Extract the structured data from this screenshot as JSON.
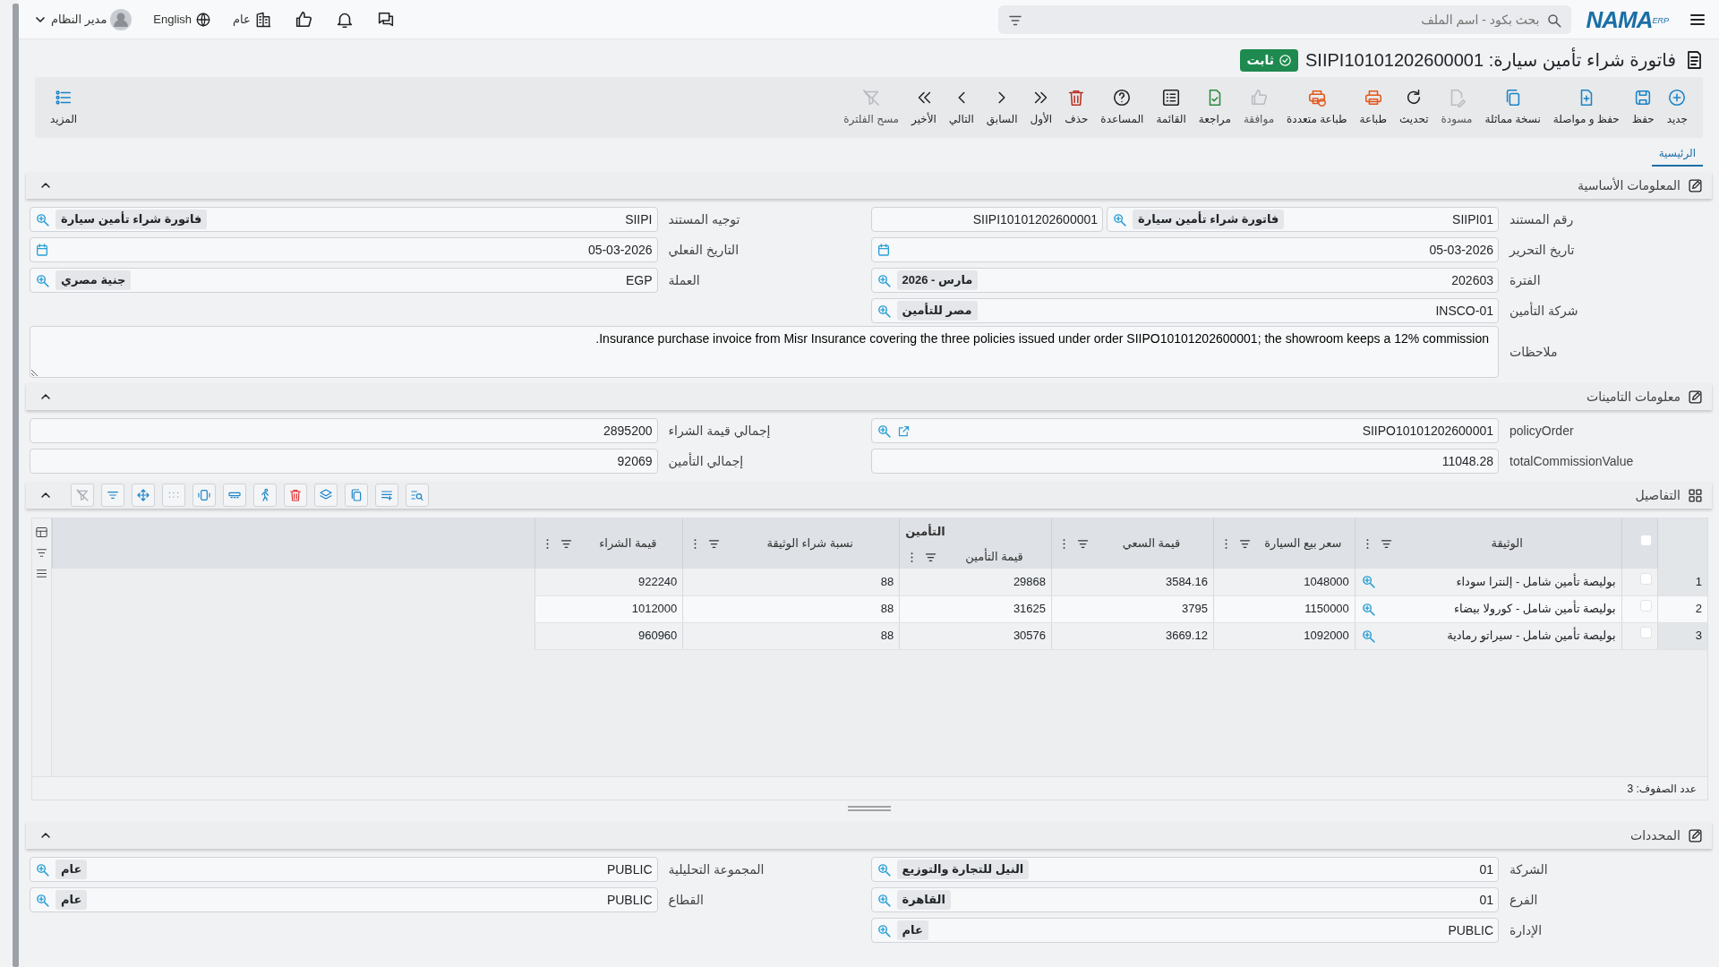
{
  "header": {
    "logo": "NAMA",
    "logo_sub": "ERP",
    "search_placeholder": "بحث بكود - اسم الملف",
    "branch": "عام",
    "language": "English",
    "user": "مدير النظام"
  },
  "title": {
    "text": "فاتورة شراء تأمين سيارة: SIIPI10101202600001",
    "status": "ثابت"
  },
  "toolbar": [
    {
      "label": "جديد",
      "disabled": false
    },
    {
      "label": "حفظ",
      "disabled": false
    },
    {
      "label": "حفظ و مواصلة",
      "disabled": false
    },
    {
      "label": "نسخة مماثلة",
      "disabled": false
    },
    {
      "label": "مسودة",
      "disabled": true
    },
    {
      "label": "تحديث",
      "disabled": false
    },
    {
      "label": "طباعة",
      "disabled": false
    },
    {
      "label": "طباعة متعددة",
      "disabled": false
    },
    {
      "label": "موافقة",
      "disabled": true
    },
    {
      "label": "مراجعة",
      "disabled": false
    },
    {
      "label": "القائمة",
      "disabled": false
    },
    {
      "label": "المساعدة",
      "disabled": false
    },
    {
      "label": "حذف",
      "disabled": false
    },
    {
      "label": "الأول",
      "disabled": false
    },
    {
      "label": "السابق",
      "disabled": false
    },
    {
      "label": "التالي",
      "disabled": false
    },
    {
      "label": "الأخير",
      "disabled": false
    },
    {
      "label": "مسح الفلترة",
      "disabled": true
    }
  ],
  "more": "المزيد",
  "tabs": [
    {
      "label": "الرئيسية",
      "selected": true
    }
  ],
  "sections": [
    {
      "kind": "form",
      "title": "المعلومات الأساسية",
      "expanded": true,
      "rows": [
        [
          {
            "label": "رقم المستند",
            "kind": "lookup",
            "value": "SIIPI01",
            "chip": "فاتورة شراء تأمين سيارة",
            "extra": "SIIPI10101202600001"
          },
          {
            "label": "توجيه المستند",
            "kind": "lookup",
            "value": "SIIPI",
            "chip": "فاتورة شراء تأمين سيارة"
          }
        ],
        [
          {
            "label": "تاريخ التحرير",
            "kind": "date",
            "value": "05-03-2026"
          },
          {
            "label": "التاريخ الفعلي",
            "kind": "date",
            "value": "05-03-2026"
          }
        ],
        [
          {
            "label": "الفترة",
            "kind": "lookup",
            "value": "202603",
            "chip": "مارس - 2026"
          },
          {
            "label": "العملة",
            "kind": "lookup",
            "value": "EGP",
            "chip": "جنية مصري"
          }
        ],
        [
          {
            "label": "شركة التأمين",
            "kind": "lookup",
            "value": "INSCO-01",
            "chip": "مصر للتأمين"
          }
        ],
        [
          {
            "label": "ملاحظات",
            "kind": "notes",
            "value": "Insurance purchase invoice from Misr Insurance covering the three policies issued under order SIIPO10101202600001; the showroom keeps a 12% commission."
          }
        ]
      ]
    },
    {
      "kind": "form",
      "title": "معلومات التامينات",
      "expanded": true,
      "rows": [
        [
          {
            "label": "policyOrder",
            "kind": "link",
            "value": "SIIPO10101202600001"
          },
          {
            "label": "إجمالي قيمة الشراء",
            "kind": "text",
            "value": "2895200"
          }
        ],
        [
          {
            "label": "totalCommissionValue",
            "kind": "text",
            "value": "11048.28"
          },
          {
            "label": "إجمالي التأمين",
            "kind": "text",
            "value": "92069"
          }
        ]
      ]
    },
    {
      "kind": "grid",
      "title": "التفاصيل",
      "expanded": true,
      "tools": [
        {
          "disabled": false
        },
        {
          "disabled": false
        },
        {
          "disabled": false
        },
        {
          "disabled": false
        },
        {
          "disabled": false
        },
        {
          "disabled": false
        },
        {
          "disabled": false
        },
        {
          "disabled": false
        },
        {
          "disabled": false
        },
        {
          "disabled": false
        },
        {
          "disabled": false
        },
        {
          "disabled": true
        }
      ],
      "select_all": false,
      "columns": [
        {
          "label": "الوثيقة"
        },
        {
          "label": "سعر بيع السيارة"
        },
        {
          "label": "قيمة السعي"
        },
        {
          "label": "قيمة التأمين",
          "group": "التأمين"
        },
        {
          "label": "نسبة شراء الوثيقة"
        },
        {
          "label": "قيمة الشراء"
        }
      ],
      "rows": [
        {
          "index": "1",
          "checked": false,
          "cells": [
            "بوليصة تأمين شامل - إلنترا سوداء",
            "1048000",
            "3584.16",
            "29868",
            "88",
            "922240"
          ]
        },
        {
          "index": "2",
          "checked": false,
          "cells": [
            "بوليصة تأمين شامل - كورولا بيضاء",
            "1150000",
            "3795",
            "31625",
            "88",
            "1012000"
          ]
        },
        {
          "index": "3",
          "checked": false,
          "cells": [
            "بوليصة تأمين شامل - سيراتو رمادية",
            "1092000",
            "3669.12",
            "30576",
            "88",
            "960960"
          ]
        }
      ],
      "row_count": "عدد الصفوف: 3"
    },
    {
      "kind": "form",
      "title": "المحددات",
      "expanded": true,
      "rows": [
        [
          {
            "label": "الشركة",
            "kind": "lookup",
            "value": "01",
            "chip": "النيل للتجارة والتوزيع"
          },
          {
            "label": "المجموعة التحليلية",
            "kind": "lookup",
            "value": "PUBLIC",
            "chip": "عام"
          }
        ],
        [
          {
            "label": "الفرع",
            "kind": "lookup",
            "value": "01",
            "chip": "القاهرة"
          },
          {
            "label": "القطاع",
            "kind": "lookup",
            "value": "PUBLIC",
            "chip": "عام"
          }
        ],
        [
          {
            "label": "الإدارة",
            "kind": "lookup",
            "value": "PUBLIC",
            "chip": "عام"
          }
        ]
      ]
    }
  ]
}
